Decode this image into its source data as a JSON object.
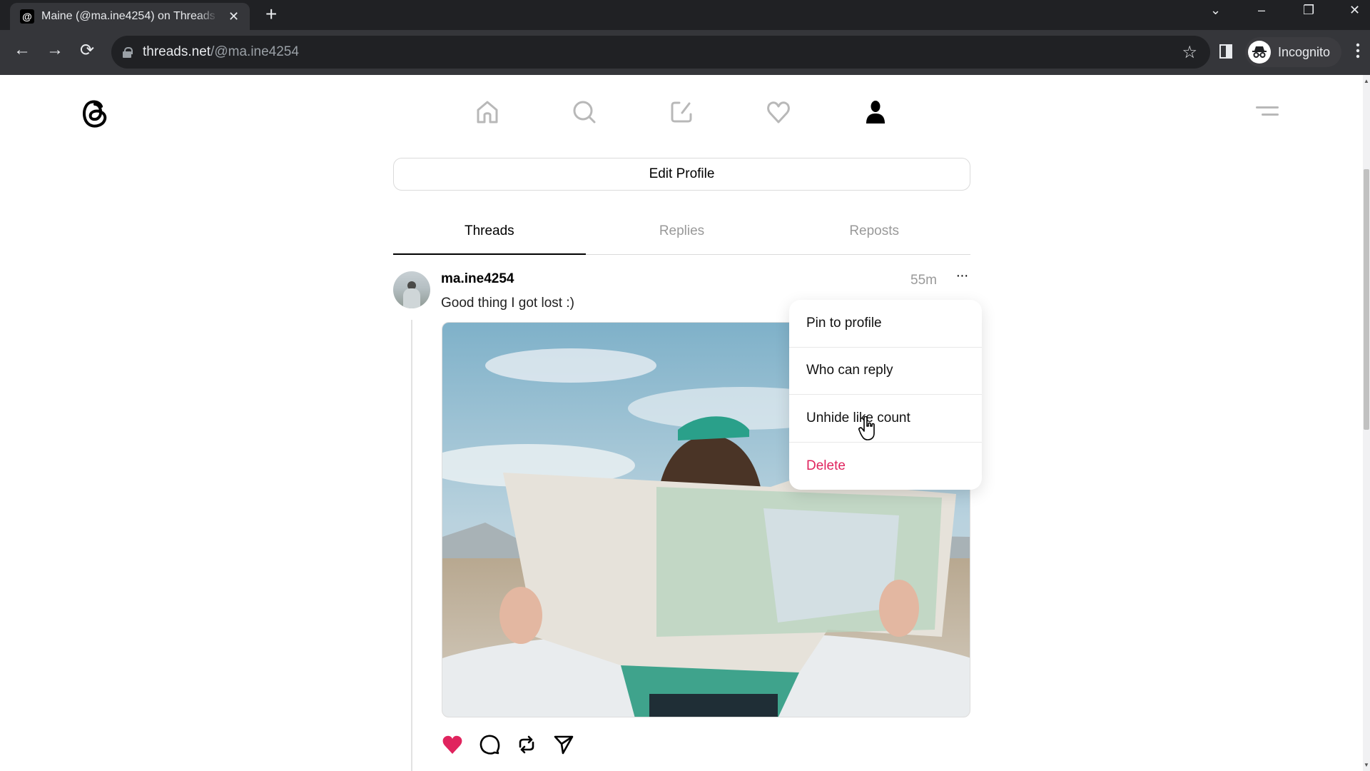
{
  "browser": {
    "tab_title": "Maine (@ma.ine4254) on Threads",
    "tab_close": "✕",
    "new_tab": "+",
    "url_host": "threads.net",
    "url_path": "/@ma.ine4254",
    "profile_label": "Incognito",
    "icons": {
      "back": "←",
      "forward": "→",
      "reload": "⟳",
      "star": "☆",
      "tab_search": "⌄",
      "minimize": "–",
      "restore": "❐",
      "close": "✕",
      "kebab": "⋮",
      "incognito": "🕶"
    }
  },
  "app": {
    "nav": [
      {
        "name": "home",
        "active": false
      },
      {
        "name": "search",
        "active": false
      },
      {
        "name": "compose",
        "active": false
      },
      {
        "name": "activity",
        "active": false
      },
      {
        "name": "profile",
        "active": true
      }
    ],
    "edit_profile_label": "Edit Profile",
    "tabs": [
      {
        "label": "Threads",
        "active": true
      },
      {
        "label": "Replies",
        "active": false
      },
      {
        "label": "Reposts",
        "active": false
      }
    ],
    "post": {
      "username": "ma.ine4254",
      "text": "Good thing I got lost :)",
      "time": "55m",
      "more": "···",
      "liked": true
    },
    "dropdown": {
      "items": [
        {
          "label": "Pin to profile",
          "danger": false
        },
        {
          "label": "Who can reply",
          "danger": false
        },
        {
          "label": "Unhide like count",
          "danger": false
        },
        {
          "label": "Delete",
          "danger": true
        }
      ]
    },
    "colors": {
      "like_red": "#e0245e",
      "delete_red": "#e0245e",
      "inactive_gray": "#999999"
    }
  }
}
